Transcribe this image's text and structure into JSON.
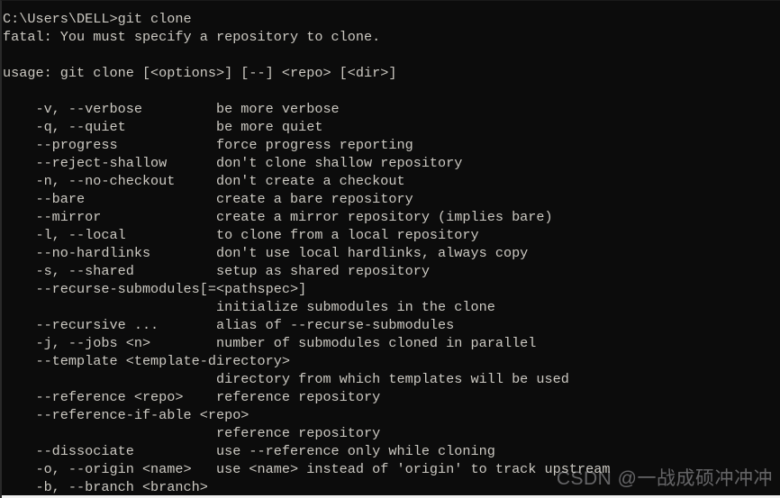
{
  "terminal": {
    "background_color": "#0c0c0c",
    "text_color": "#ccc9c2",
    "prompt_line": "C:\\Users\\DELL>git clone",
    "error_line": "fatal: You must specify a repository to clone.",
    "usage_line": "usage: git clone [<options>] [--] <repo> [<dir>]",
    "lines": [
      "C:\\Users\\DELL>git clone",
      "fatal: You must specify a repository to clone.",
      "",
      "usage: git clone [<options>] [--] <repo> [<dir>]",
      "",
      "    -v, --verbose         be more verbose",
      "    -q, --quiet           be more quiet",
      "    --progress            force progress reporting",
      "    --reject-shallow      don't clone shallow repository",
      "    -n, --no-checkout     don't create a checkout",
      "    --bare                create a bare repository",
      "    --mirror              create a mirror repository (implies bare)",
      "    -l, --local           to clone from a local repository",
      "    --no-hardlinks        don't use local hardlinks, always copy",
      "    -s, --shared          setup as shared repository",
      "    --recurse-submodules[=<pathspec>]",
      "                          initialize submodules in the clone",
      "    --recursive ...       alias of --recurse-submodules",
      "    -j, --jobs <n>        number of submodules cloned in parallel",
      "    --template <template-directory>",
      "                          directory from which templates will be used",
      "    --reference <repo>    reference repository",
      "    --reference-if-able <repo>",
      "                          reference repository",
      "    --dissociate          use --reference only while cloning",
      "    -o, --origin <name>   use <name> instead of 'origin' to track upstream",
      "    -b, --branch <branch>"
    ],
    "options": [
      {
        "flag": "-v, --verbose",
        "description": "be more verbose"
      },
      {
        "flag": "-q, --quiet",
        "description": "be more quiet"
      },
      {
        "flag": "--progress",
        "description": "force progress reporting"
      },
      {
        "flag": "--reject-shallow",
        "description": "don't clone shallow repository"
      },
      {
        "flag": "-n, --no-checkout",
        "description": "don't create a checkout"
      },
      {
        "flag": "--bare",
        "description": "create a bare repository"
      },
      {
        "flag": "--mirror",
        "description": "create a mirror repository (implies bare)"
      },
      {
        "flag": "-l, --local",
        "description": "to clone from a local repository"
      },
      {
        "flag": "--no-hardlinks",
        "description": "don't use local hardlinks, always copy"
      },
      {
        "flag": "-s, --shared",
        "description": "setup as shared repository"
      },
      {
        "flag": "--recurse-submodules[=<pathspec>]",
        "description": "initialize submodules in the clone"
      },
      {
        "flag": "--recursive ...",
        "description": "alias of --recurse-submodules"
      },
      {
        "flag": "-j, --jobs <n>",
        "description": "number of submodules cloned in parallel"
      },
      {
        "flag": "--template <template-directory>",
        "description": "directory from which templates will be used"
      },
      {
        "flag": "--reference <repo>",
        "description": "reference repository"
      },
      {
        "flag": "--reference-if-able <repo>",
        "description": "reference repository"
      },
      {
        "flag": "--dissociate",
        "description": "use --reference only while cloning"
      },
      {
        "flag": "-o, --origin <name>",
        "description": "use <name> instead of 'origin' to track upstream"
      },
      {
        "flag": "-b, --branch <branch>",
        "description": ""
      }
    ]
  },
  "watermark": {
    "text": "CSDN @一战成硕冲冲冲"
  }
}
